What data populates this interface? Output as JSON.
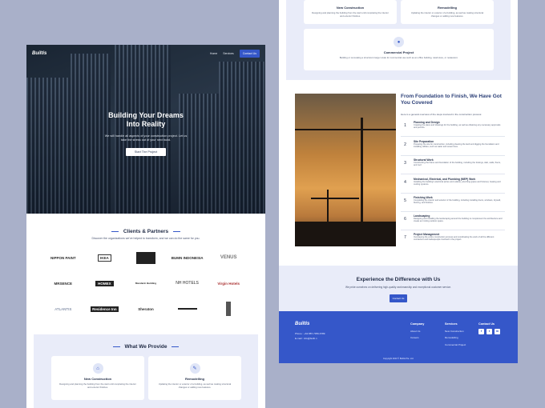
{
  "brand": "Builtis",
  "nav": {
    "home": "Home",
    "services": "Services",
    "contact": "Contact Us"
  },
  "hero": {
    "title": "Building Your Dreams Into Reality",
    "subtitle": "We will handle all aspects of your construction project. Let us take the stress out of your next build.",
    "button": "Start The Project"
  },
  "clients": {
    "title": "Clients & Partners",
    "subtitle": "Discover the organizations we've helped to transform, and we can do the same for you.",
    "logos": [
      "NIPPON PAINT",
      "IKEA",
      "",
      "BUMN INDONESIA",
      "VENUS",
      "MRSENCE",
      "HOMEX",
      "Mandarin Building",
      "NH HOTELS",
      "Virgin Hotels",
      "ATLANTIS",
      "Residence Inn",
      "Sheraton",
      "",
      ""
    ]
  },
  "provide": {
    "title": "What We Provide",
    "cards": [
      {
        "icon": "home-icon",
        "title": "New Construction",
        "desc": "Designing and planning the building from the start until completing the interior and exterior finishes."
      },
      {
        "icon": "hammer-icon",
        "title": "Remodelling",
        "desc": "Updating the interior or exterior of a building, as well as making structural changes or adding new features."
      }
    ]
  },
  "top_cards": [
    {
      "title": "New Construction",
      "desc": "Designing and planning the building from the start until completing the interior and exterior finishes."
    },
    {
      "title": "Remodelling",
      "desc": "Updating the interior or exterior of a building, as well as making structural changes or adding new features."
    },
    {
      "icon": "user-icon",
      "title": "Commercial Project",
      "desc": "Building or renovating a structure's larger scale for commercial use such as an office building, retail store, or restaurant."
    }
  ],
  "process": {
    "title": "From Foundation to Finish, We Have Got You Covered",
    "subtitle": "Here is a general overview of the steps involved in the construction process:",
    "steps": [
      {
        "num": "1",
        "title": "Planning and Design",
        "desc": "Creating the plans and drawings for the building, as well as obtaining any necessary approvals and permits."
      },
      {
        "num": "2",
        "title": "Site Preparation",
        "desc": "Preparing the site for construction, including clearing the land and digging the foundation and installing utilities, such as water and sewer lines."
      },
      {
        "num": "3",
        "title": "Structural Work",
        "desc": "Constructing the frame and foundation of the building, including the footings, slab, walls, floors, and roof."
      },
      {
        "num": "4",
        "title": "Mechanical, Electrical, and Plumbing (MEP) Work",
        "desc": "Installing the building's electrical (wires and outlets), plumbing (pipes and fixtures), heating and cooling systems."
      },
      {
        "num": "5",
        "title": "Finishing Work",
        "desc": "Completing the interior and exterior of the building, including installing doors, windows, drywall, flooring, and finishes."
      },
      {
        "num": "6",
        "title": "Landscaping",
        "desc": "Designing and installing the landscaping around the building to complement the architecture and create an inviting outdoor space."
      },
      {
        "num": "7",
        "title": "Project Management",
        "desc": "Overseeing the entire construction process and coordinating the work of all the different contractors and tradespeople involved in the project."
      }
    ]
  },
  "cta": {
    "title": "Experience the Difference with Us",
    "subtitle": "We pride ourselves on delivering high-quality workmanship and exceptional customer service.",
    "button": "Contact Us"
  },
  "footer": {
    "logo": "Builtis",
    "phone": "Phone : +62 887-7356-6789",
    "email": "E-mail : info@builti.n",
    "company": {
      "heading": "Company",
      "items": [
        "About Us",
        "Careers"
      ]
    },
    "services": {
      "heading": "Services",
      "items": [
        "New Construction",
        "Remodelling",
        "Commercial Project"
      ]
    },
    "contact": {
      "heading": "Contact Us"
    },
    "copyright": "Copyright 2023 © Builtis Pte. Ltd."
  }
}
